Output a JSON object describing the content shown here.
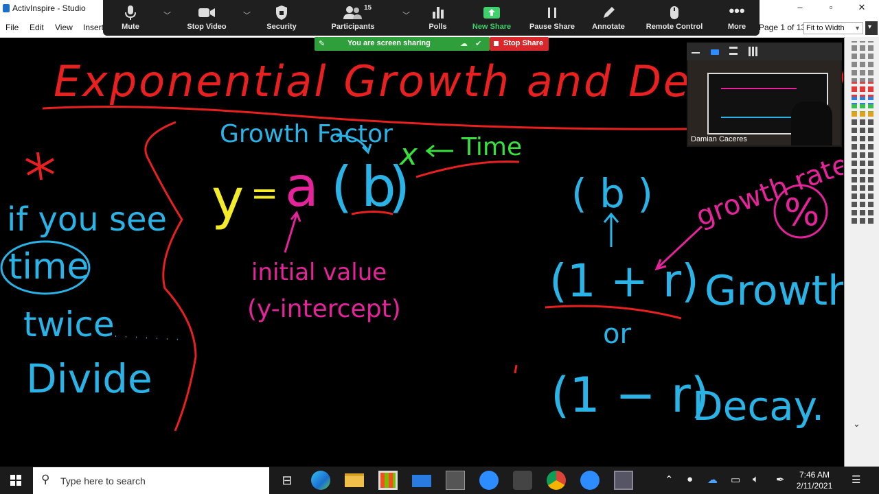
{
  "app": {
    "title": "ActivInspire - Studio",
    "menu": [
      "File",
      "Edit",
      "View",
      "Insert"
    ],
    "page_indicator": "Page 1 of 13",
    "zoom_value": "Fit to Width",
    "window_controls": [
      "–",
      "▫",
      "✕"
    ]
  },
  "zoom_toolbar": {
    "buttons": [
      {
        "label": "Mute",
        "icon": "microphone-icon"
      },
      {
        "label": "Stop Video",
        "icon": "video-camera-icon"
      },
      {
        "label": "Security",
        "icon": "shield-icon"
      },
      {
        "label": "Participants",
        "icon": "participants-icon",
        "count": "15"
      },
      {
        "label": "Polls",
        "icon": "polls-icon"
      },
      {
        "label": "New Share",
        "icon": "share-arrow-icon"
      },
      {
        "label": "Pause Share",
        "icon": "pause-icon"
      },
      {
        "label": "Annotate",
        "icon": "pencil-icon"
      },
      {
        "label": "Remote Control",
        "icon": "mouse-icon"
      },
      {
        "label": "More",
        "icon": "ellipsis-icon"
      }
    ]
  },
  "share_banner": {
    "text": "You are screen sharing",
    "stop_label": "Stop Share"
  },
  "video": {
    "participant_name": "Damian Caceres"
  },
  "whiteboard": {
    "title": "Exponential Growth and Decay (Wo",
    "growth_factor": "Growth Factor",
    "time": "Time",
    "exponent": "x",
    "formula": {
      "y": "y",
      "eq": "=",
      "a": "a",
      "b": "b"
    },
    "initial_value": "initial value",
    "y_intercept": "(y-intercept)",
    "if_you_see": "if you see",
    "keywords": [
      "time",
      "twice",
      "Divide"
    ],
    "b_paren": "( b )",
    "growth_rate": "growth rate",
    "percent": "%",
    "one_plus_r": "(1 + r)",
    "growth": "Growth",
    "or": "or",
    "one_minus_r": "(1 − r)",
    "decay": "Decay."
  },
  "taskbar": {
    "search_placeholder": "Type here to search",
    "time": "7:46 AM",
    "date": "2/11/2021"
  },
  "colors": {
    "red": "#e8201f",
    "cyan": "#2ab3e6",
    "magenta": "#e5239a",
    "yellow": "#f4ec2b",
    "green": "#38e23c",
    "zoom_green": "#3fd16b",
    "stop_red": "#d9282b"
  }
}
